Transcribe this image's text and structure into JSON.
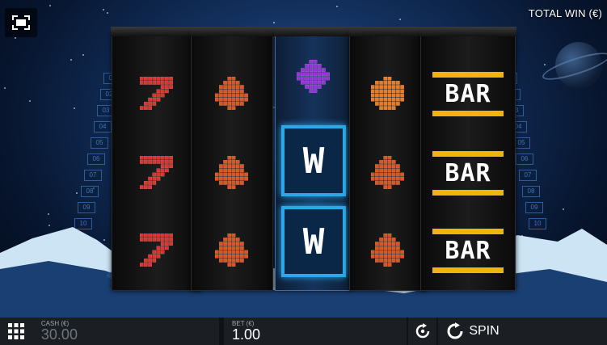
{
  "header": {
    "total_win_label": "TOTAL WIN (€)"
  },
  "payline_numbers": [
    "01",
    "02",
    "03",
    "04",
    "05",
    "06",
    "07",
    "08",
    "09",
    "10"
  ],
  "reels": [
    {
      "symbols": [
        "seven-symbol",
        "seven-symbol",
        "seven-symbol"
      ]
    },
    {
      "symbols": [
        "bell-symbol",
        "bell-symbol",
        "bell-symbol"
      ]
    },
    {
      "symbols": [
        "plum-symbol",
        "wild-symbol",
        "wild-symbol"
      ]
    },
    {
      "symbols": [
        "orange-symbol",
        "bell-symbol",
        "bell-symbol"
      ]
    },
    {
      "symbols": [
        "bar-symbol",
        "bar-symbol",
        "bar-symbol"
      ]
    }
  ],
  "symbol_text": {
    "wild": "W",
    "bar": "BAR"
  },
  "footer": {
    "cash_label": "CASH (€)",
    "cash_value": "30.00",
    "bet_label": "BET (€)",
    "bet_value": "1.00",
    "spin_label": "SPIN"
  },
  "colors": {
    "seven": "#e2312a",
    "bell": "#e0531d",
    "plum": "#9b2fe0",
    "orange": "#f07a1b",
    "wild": "#2ba8e8",
    "bar": "#ffffff",
    "bar_stripe": "#f2b30f"
  }
}
